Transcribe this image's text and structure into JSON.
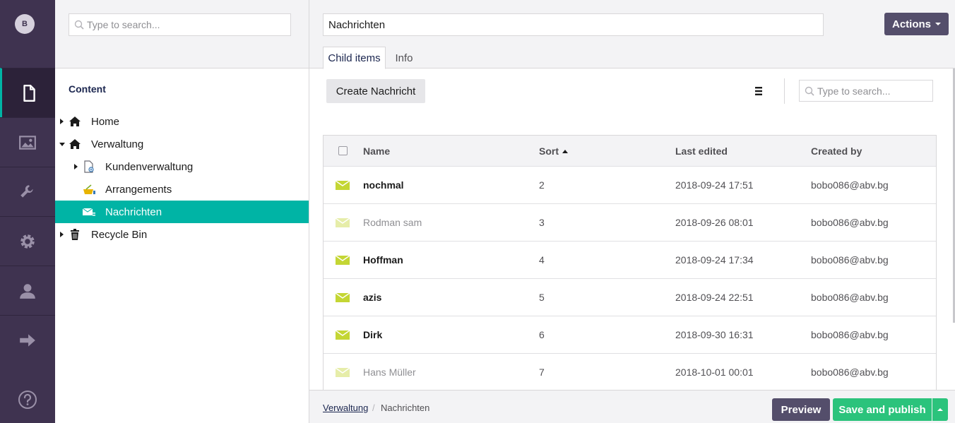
{
  "user": {
    "initial": "B"
  },
  "rail": {
    "items": [
      {
        "name": "content",
        "icon": "document-icon",
        "active": true
      },
      {
        "name": "media",
        "icon": "image-icon",
        "active": false
      },
      {
        "name": "settings",
        "icon": "wrench-icon",
        "active": false
      },
      {
        "name": "developer",
        "icon": "gear-icon",
        "active": false
      },
      {
        "name": "users",
        "icon": "user-icon",
        "active": false
      },
      {
        "name": "forms",
        "icon": "arrow-right-icon",
        "active": false
      }
    ],
    "help_icon": "question-icon"
  },
  "tree": {
    "search_placeholder": "Type to search...",
    "title": "Content",
    "nodes": [
      {
        "label": "Home",
        "icon": "home-icon",
        "caret": "right",
        "level": 0,
        "selected": false
      },
      {
        "label": "Verwaltung",
        "icon": "home-icon",
        "caret": "down",
        "level": 0,
        "selected": false
      },
      {
        "label": "Kundenverwaltung",
        "icon": "document-plus-icon",
        "caret": "right",
        "level": 1,
        "selected": false
      },
      {
        "label": "Arrangements",
        "icon": "basket-icon",
        "caret": "",
        "level": 1,
        "selected": false
      },
      {
        "label": "Nachrichten",
        "icon": "envelope-list-icon",
        "caret": "",
        "level": 1,
        "selected": true
      },
      {
        "label": "Recycle Bin",
        "icon": "trash-icon",
        "caret": "right",
        "level": 0,
        "selected": false
      }
    ]
  },
  "editor": {
    "node_name": "Nachrichten",
    "actions_label": "Actions",
    "tabs": [
      {
        "label": "Child items",
        "active": true
      },
      {
        "label": "Info",
        "active": false
      }
    ],
    "create_label": "Create Nachricht",
    "list_search_placeholder": "Type to search...",
    "columns": {
      "name": "Name",
      "sort": "Sort",
      "last_edited": "Last edited",
      "created_by": "Created by"
    },
    "rows": [
      {
        "name": "nochmal",
        "sort": "2",
        "last_edited": "2018-09-24 17:51",
        "created_by": "bobo086@abv.bg",
        "published": true
      },
      {
        "name": "Rodman sam",
        "sort": "3",
        "last_edited": "2018-09-26 08:01",
        "created_by": "bobo086@abv.bg",
        "published": false
      },
      {
        "name": "Hoffman",
        "sort": "4",
        "last_edited": "2018-09-24 17:34",
        "created_by": "bobo086@abv.bg",
        "published": true
      },
      {
        "name": "azis",
        "sort": "5",
        "last_edited": "2018-09-24 22:51",
        "created_by": "bobo086@abv.bg",
        "published": true
      },
      {
        "name": "Dirk",
        "sort": "6",
        "last_edited": "2018-09-30 16:31",
        "created_by": "bobo086@abv.bg",
        "published": true
      },
      {
        "name": "Hans Müller",
        "sort": "7",
        "last_edited": "2018-10-01 00:01",
        "created_by": "bobo086@abv.bg",
        "published": false
      }
    ]
  },
  "footer": {
    "breadcrumb": [
      "Verwaltung",
      "Nachrichten"
    ],
    "separator": "/",
    "preview_label": "Preview",
    "save_label": "Save and publish"
  },
  "colors": {
    "rail_bg": "#3f3350",
    "selected": "#00b4a5",
    "save": "#2bc37c",
    "action": "#544e6b",
    "mail_published": "#c4d634",
    "mail_unpublished": "#e6eda9"
  }
}
